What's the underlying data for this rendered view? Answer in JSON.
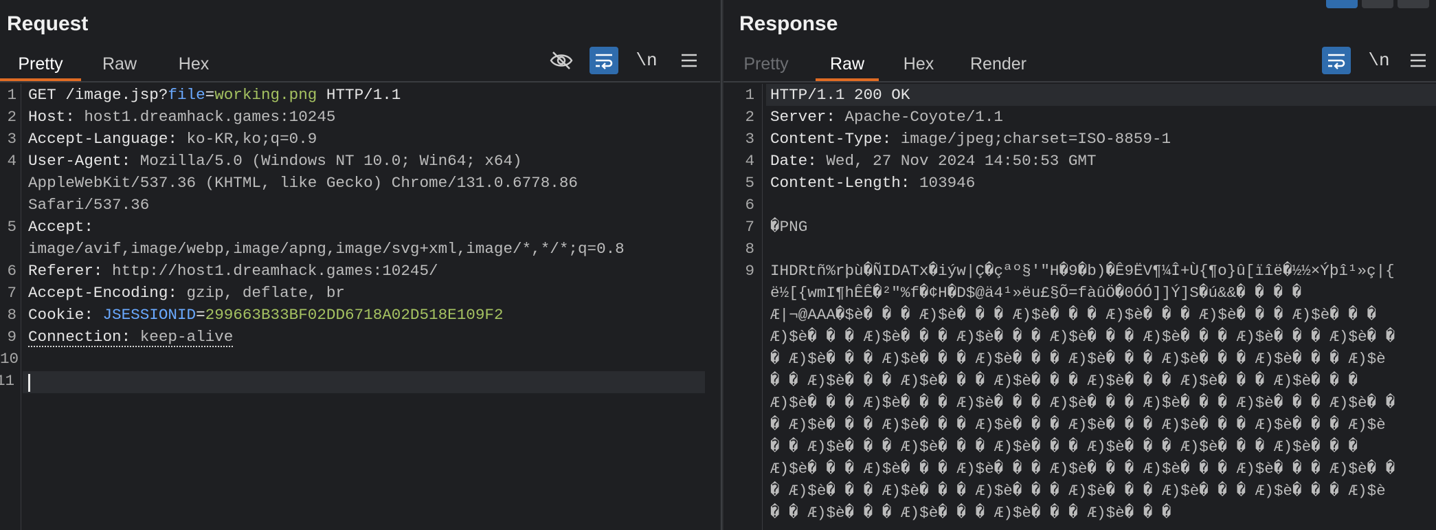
{
  "request": {
    "title": "Request",
    "tabs": [
      {
        "label": "Pretty",
        "state": "active"
      },
      {
        "label": "Raw",
        "state": "normal"
      },
      {
        "label": "Hex",
        "state": "normal"
      }
    ],
    "toolbar": {
      "hide_icon": "eye-slash-icon",
      "wrap_icon": "wrap-text-icon",
      "newline_label": "\\n",
      "menu_icon": "hamburger-menu-icon"
    },
    "lines": [
      {
        "n": "1",
        "method": "GET",
        "path": " /image.jsp?",
        "param_key": "file",
        "eq": "=",
        "param_val": "working.png",
        "proto": " HTTP/1.1"
      },
      {
        "n": "2",
        "name": "Host:",
        "value": " host1.dreamhack.games:10245"
      },
      {
        "n": "3",
        "name": "Accept-Language:",
        "value": " ko-KR,ko;q=0.9"
      },
      {
        "n": "4",
        "name": "User-Agent:",
        "value": " Mozilla/5.0 (Windows NT 10.0; Win64; x64)",
        "cont": [
          "AppleWebKit/537.36 (KHTML, like Gecko) Chrome/131.0.6778.86",
          "Safari/537.36"
        ]
      },
      {
        "n": "5",
        "name": "Accept:",
        "value": "",
        "cont": [
          "image/avif,image/webp,image/apng,image/svg+xml,image/*,*/*;q=0.8"
        ]
      },
      {
        "n": "6",
        "name": "Referer:",
        "value": " http://host1.dreamhack.games:10245/"
      },
      {
        "n": "7",
        "name": "Accept-Encoding:",
        "value": " gzip, deflate, br"
      },
      {
        "n": "8",
        "name": "Cookie:",
        "value": " ",
        "cookie_key": "JSESSIONID",
        "cookie_eq": "=",
        "cookie_val": "299663B33BF02DD6718A02D518E109F2"
      },
      {
        "n": "9",
        "name": "Connection:",
        "value": " keep-alive"
      },
      {
        "n": "10",
        "text": ""
      },
      {
        "n": "11",
        "text": ""
      }
    ]
  },
  "response": {
    "title": "Response",
    "tabs": [
      {
        "label": "Pretty",
        "state": "disabled"
      },
      {
        "label": "Raw",
        "state": "active"
      },
      {
        "label": "Hex",
        "state": "normal"
      },
      {
        "label": "Render",
        "state": "normal"
      }
    ],
    "toolbar": {
      "wrap_icon": "wrap-text-icon",
      "newline_label": "\\n",
      "menu_icon": "hamburger-menu-icon"
    },
    "lines": [
      {
        "n": "1",
        "status": "HTTP/1.1 200 OK"
      },
      {
        "n": "2",
        "name": "Server:",
        "value": " Apache-Coyote/1.1"
      },
      {
        "n": "3",
        "name": "Content-Type:",
        "value": " image/jpeg;charset=ISO-8859-1"
      },
      {
        "n": "4",
        "name": "Date:",
        "value": " Wed, 27 Nov 2024 14:50:53 GMT"
      },
      {
        "n": "5",
        "name": "Content-Length:",
        "value": " 103946"
      },
      {
        "n": "6",
        "text": ""
      },
      {
        "n": "7",
        "text": "�PNG"
      },
      {
        "n": "8",
        "text": ""
      },
      {
        "n": "9",
        "text": "IHDRtñ%rþù�ÑIDATx�iýw|Ç�çªº§'\"H�9�b)�Ê9ËV¶¼Î+Ù{¶o}û[ïîë�½½×Ýþî¹»ç|{",
        "cont": [
          "ë½[{wmI¶hÊÊ�²\"%f�¢H�D$@ä4¹»ëu£§Õ=fàûÖ�0ÓÓ]]Ý]S�ú&&� � � �",
          "Æ|¬@AAA�$è� � � Æ)$è� � � Æ)$è� � � Æ)$è� � � Æ)$è� � � Æ)$è� � �",
          "Æ)$è� � � Æ)$è� � � Æ)$è� � � Æ)$è� � � Æ)$è� � � Æ)$è� � � Æ)$è� �",
          "� Æ)$è� � � Æ)$è� � � Æ)$è� � � Æ)$è� � � Æ)$è� � � Æ)$è� � � Æ)$è",
          "� � Æ)$è� � � Æ)$è� � � Æ)$è� � � Æ)$è� � � Æ)$è� � � Æ)$è� � �",
          "Æ)$è� � � Æ)$è� � � Æ)$è� � � Æ)$è� � � Æ)$è� � � Æ)$è� � � Æ)$è� �",
          "� Æ)$è� � � Æ)$è� � � Æ)$è� � � Æ)$è� � � Æ)$è� � � Æ)$è� � � Æ)$è",
          "� � Æ)$è� � � Æ)$è� � � Æ)$è� � � Æ)$è� � � Æ)$è� � � Æ)$è� � �",
          "Æ)$è� � � Æ)$è� � � Æ)$è� � � Æ)$è� � � Æ)$è� � � Æ)$è� � � Æ)$è� �",
          "� Æ)$è� � � Æ)$è� � � Æ)$è� � � Æ)$è� � � Æ)$è� � � Æ)$è� � � Æ)$è",
          "� � Æ)$è� � � Æ)$è� � � Æ)$è� � � Æ)$è� � �"
        ]
      }
    ]
  },
  "layout_toggle_icons": [
    "split-horizontal-icon",
    "split-vertical-icon",
    "single-pane-icon"
  ]
}
